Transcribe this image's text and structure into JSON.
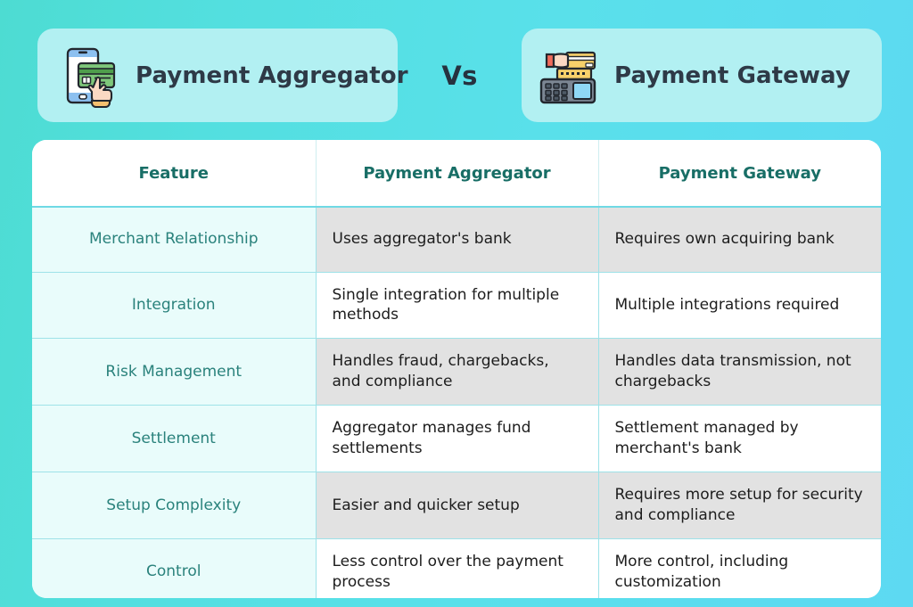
{
  "theme": {
    "bg_gradient_start": "#4ddcd2",
    "bg_gradient_end": "#5dd9f2",
    "card_bg": "#b2f0f2",
    "card_title_color": "#2e3a47",
    "table_header_color": "#186e66",
    "feature_label_color": "#2a827c",
    "feature_cell_bg": "#e9fcfb",
    "shaded_cell_bg": "#e2e2e2",
    "plain_cell_bg": "#ffffff",
    "grid_line_color": "#9ee2e8"
  },
  "header": {
    "left_card": {
      "title": "Payment Aggregator",
      "icon": "smartphone-credit-card-tap-icon"
    },
    "vs_label": "Vs",
    "right_card": {
      "title": "Payment Gateway",
      "icon": "pos-terminal-card-swipe-icon"
    }
  },
  "table": {
    "columns": [
      "Feature",
      "Payment Aggregator",
      "Payment Gateway"
    ],
    "rows": [
      {
        "feature": "Merchant Relationship",
        "aggregator": "Uses aggregator's bank",
        "gateway": "Requires own acquiring bank",
        "shaded": true
      },
      {
        "feature": "Integration",
        "aggregator": "Single integration for multiple methods",
        "gateway": "Multiple integrations required",
        "shaded": false
      },
      {
        "feature": "Risk Management",
        "aggregator": "Handles fraud, chargebacks, and compliance",
        "gateway": "Handles data transmission, not chargebacks",
        "shaded": true
      },
      {
        "feature": "Settlement",
        "aggregator": "Aggregator manages fund settlements",
        "gateway": "Settlement managed by merchant's bank",
        "shaded": false
      },
      {
        "feature": "Setup Complexity",
        "aggregator": "Easier and quicker setup",
        "gateway": "Requires more setup for security and compliance",
        "shaded": true
      },
      {
        "feature": "Control",
        "aggregator": "Less control over the payment process",
        "gateway": "More control, including customization",
        "shaded": false
      }
    ]
  }
}
